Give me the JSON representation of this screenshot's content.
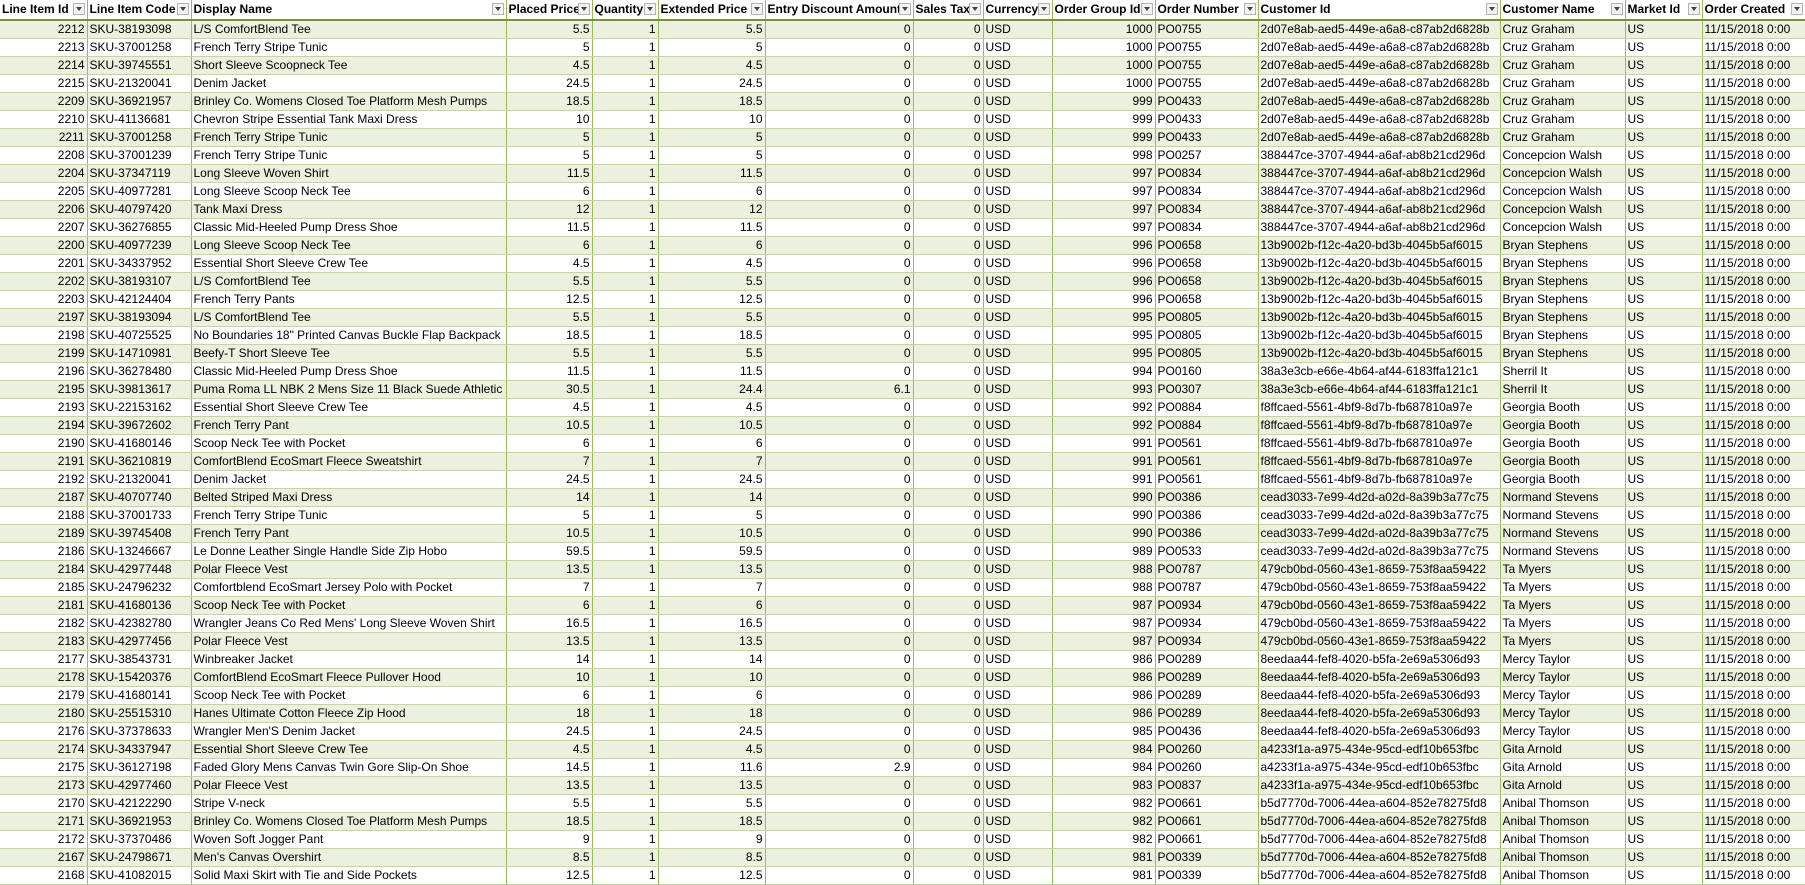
{
  "columns": [
    {
      "label": "Line Item Id",
      "align": "num"
    },
    {
      "label": "Line Item Code",
      "align": "txt"
    },
    {
      "label": "Display Name",
      "align": "txt"
    },
    {
      "label": "Placed Price",
      "align": "num"
    },
    {
      "label": "Quantity",
      "align": "num"
    },
    {
      "label": "Extended Price",
      "align": "num"
    },
    {
      "label": "Entry Discount Amount",
      "align": "num"
    },
    {
      "label": "Sales Tax",
      "align": "num"
    },
    {
      "label": "Currency",
      "align": "txt"
    },
    {
      "label": "Order Group Id",
      "align": "num"
    },
    {
      "label": "Order Number",
      "align": "txt"
    },
    {
      "label": "Customer Id",
      "align": "txt"
    },
    {
      "label": "Customer Name",
      "align": "txt"
    },
    {
      "label": "Market Id",
      "align": "txt"
    },
    {
      "label": "Order Created",
      "align": "txt"
    }
  ],
  "rows": [
    [
      "2212",
      "SKU-38193098",
      "L/S ComfortBlend Tee",
      "5.5",
      "1",
      "5.5",
      "0",
      "0",
      "USD",
      "1000",
      "PO0755",
      "2d07e8ab-aed5-449e-a6a8-c87ab2d6828b",
      "Cruz Graham",
      "US",
      "11/15/2018 0:00"
    ],
    [
      "2213",
      "SKU-37001258",
      "French Terry Stripe Tunic",
      "5",
      "1",
      "5",
      "0",
      "0",
      "USD",
      "1000",
      "PO0755",
      "2d07e8ab-aed5-449e-a6a8-c87ab2d6828b",
      "Cruz Graham",
      "US",
      "11/15/2018 0:00"
    ],
    [
      "2214",
      "SKU-39745551",
      "Short Sleeve Scoopneck Tee",
      "4.5",
      "1",
      "4.5",
      "0",
      "0",
      "USD",
      "1000",
      "PO0755",
      "2d07e8ab-aed5-449e-a6a8-c87ab2d6828b",
      "Cruz Graham",
      "US",
      "11/15/2018 0:00"
    ],
    [
      "2215",
      "SKU-21320041",
      "Denim Jacket",
      "24.5",
      "1",
      "24.5",
      "0",
      "0",
      "USD",
      "1000",
      "PO0755",
      "2d07e8ab-aed5-449e-a6a8-c87ab2d6828b",
      "Cruz Graham",
      "US",
      "11/15/2018 0:00"
    ],
    [
      "2209",
      "SKU-36921957",
      "Brinley Co. Womens Closed Toe Platform Mesh Pumps",
      "18.5",
      "1",
      "18.5",
      "0",
      "0",
      "USD",
      "999",
      "PO0433",
      "2d07e8ab-aed5-449e-a6a8-c87ab2d6828b",
      "Cruz Graham",
      "US",
      "11/15/2018 0:00"
    ],
    [
      "2210",
      "SKU-41136681",
      "Chevron Stripe Essential Tank Maxi Dress",
      "10",
      "1",
      "10",
      "0",
      "0",
      "USD",
      "999",
      "PO0433",
      "2d07e8ab-aed5-449e-a6a8-c87ab2d6828b",
      "Cruz Graham",
      "US",
      "11/15/2018 0:00"
    ],
    [
      "2211",
      "SKU-37001258",
      "French Terry Stripe Tunic",
      "5",
      "1",
      "5",
      "0",
      "0",
      "USD",
      "999",
      "PO0433",
      "2d07e8ab-aed5-449e-a6a8-c87ab2d6828b",
      "Cruz Graham",
      "US",
      "11/15/2018 0:00"
    ],
    [
      "2208",
      "SKU-37001239",
      "French Terry Stripe Tunic",
      "5",
      "1",
      "5",
      "0",
      "0",
      "USD",
      "998",
      "PO0257",
      "388447ce-3707-4944-a6af-ab8b21cd296d",
      "Concepcion Walsh",
      "US",
      "11/15/2018 0:00"
    ],
    [
      "2204",
      "SKU-37347119",
      "Long Sleeve Woven Shirt",
      "11.5",
      "1",
      "11.5",
      "0",
      "0",
      "USD",
      "997",
      "PO0834",
      "388447ce-3707-4944-a6af-ab8b21cd296d",
      "Concepcion Walsh",
      "US",
      "11/15/2018 0:00"
    ],
    [
      "2205",
      "SKU-40977281",
      "Long Sleeve Scoop Neck Tee",
      "6",
      "1",
      "6",
      "0",
      "0",
      "USD",
      "997",
      "PO0834",
      "388447ce-3707-4944-a6af-ab8b21cd296d",
      "Concepcion Walsh",
      "US",
      "11/15/2018 0:00"
    ],
    [
      "2206",
      "SKU-40797420",
      "Tank Maxi Dress",
      "12",
      "1",
      "12",
      "0",
      "0",
      "USD",
      "997",
      "PO0834",
      "388447ce-3707-4944-a6af-ab8b21cd296d",
      "Concepcion Walsh",
      "US",
      "11/15/2018 0:00"
    ],
    [
      "2207",
      "SKU-36276855",
      "Classic Mid-Heeled Pump Dress Shoe",
      "11.5",
      "1",
      "11.5",
      "0",
      "0",
      "USD",
      "997",
      "PO0834",
      "388447ce-3707-4944-a6af-ab8b21cd296d",
      "Concepcion Walsh",
      "US",
      "11/15/2018 0:00"
    ],
    [
      "2200",
      "SKU-40977239",
      "Long Sleeve Scoop Neck Tee",
      "6",
      "1",
      "6",
      "0",
      "0",
      "USD",
      "996",
      "PO0658",
      "13b9002b-f12c-4a20-bd3b-4045b5af6015",
      "Bryan Stephens",
      "US",
      "11/15/2018 0:00"
    ],
    [
      "2201",
      "SKU-34337952",
      "Essential Short Sleeve Crew Tee",
      "4.5",
      "1",
      "4.5",
      "0",
      "0",
      "USD",
      "996",
      "PO0658",
      "13b9002b-f12c-4a20-bd3b-4045b5af6015",
      "Bryan Stephens",
      "US",
      "11/15/2018 0:00"
    ],
    [
      "2202",
      "SKU-38193107",
      "L/S ComfortBlend Tee",
      "5.5",
      "1",
      "5.5",
      "0",
      "0",
      "USD",
      "996",
      "PO0658",
      "13b9002b-f12c-4a20-bd3b-4045b5af6015",
      "Bryan Stephens",
      "US",
      "11/15/2018 0:00"
    ],
    [
      "2203",
      "SKU-42124404",
      "French Terry Pants",
      "12.5",
      "1",
      "12.5",
      "0",
      "0",
      "USD",
      "996",
      "PO0658",
      "13b9002b-f12c-4a20-bd3b-4045b5af6015",
      "Bryan Stephens",
      "US",
      "11/15/2018 0:00"
    ],
    [
      "2197",
      "SKU-38193094",
      "L/S ComfortBlend Tee",
      "5.5",
      "1",
      "5.5",
      "0",
      "0",
      "USD",
      "995",
      "PO0805",
      "13b9002b-f12c-4a20-bd3b-4045b5af6015",
      "Bryan Stephens",
      "US",
      "11/15/2018 0:00"
    ],
    [
      "2198",
      "SKU-40725525",
      "No Boundaries 18\" Printed Canvas Buckle Flap Backpack",
      "18.5",
      "1",
      "18.5",
      "0",
      "0",
      "USD",
      "995",
      "PO0805",
      "13b9002b-f12c-4a20-bd3b-4045b5af6015",
      "Bryan Stephens",
      "US",
      "11/15/2018 0:00"
    ],
    [
      "2199",
      "SKU-14710981",
      "Beefy-T Short Sleeve Tee",
      "5.5",
      "1",
      "5.5",
      "0",
      "0",
      "USD",
      "995",
      "PO0805",
      "13b9002b-f12c-4a20-bd3b-4045b5af6015",
      "Bryan Stephens",
      "US",
      "11/15/2018 0:00"
    ],
    [
      "2196",
      "SKU-36278480",
      "Classic Mid-Heeled Pump Dress Shoe",
      "11.5",
      "1",
      "11.5",
      "0",
      "0",
      "USD",
      "994",
      "PO0160",
      "38a3e3cb-e66e-4b64-af44-6183ffa121c1",
      "Sherril It",
      "US",
      "11/15/2018 0:00"
    ],
    [
      "2195",
      "SKU-39813617",
      "Puma Roma LL NBK 2 Mens Size 11 Black Suede Athletic Sneakers",
      "30.5",
      "1",
      "24.4",
      "6.1",
      "0",
      "USD",
      "993",
      "PO0307",
      "38a3e3cb-e66e-4b64-af44-6183ffa121c1",
      "Sherril It",
      "US",
      "11/15/2018 0:00"
    ],
    [
      "2193",
      "SKU-22153162",
      "Essential Short Sleeve Crew Tee",
      "4.5",
      "1",
      "4.5",
      "0",
      "0",
      "USD",
      "992",
      "PO0884",
      "f8ffcaed-5561-4bf9-8d7b-fb687810a97e",
      "Georgia Booth",
      "US",
      "11/15/2018 0:00"
    ],
    [
      "2194",
      "SKU-39672602",
      "French Terry Pant",
      "10.5",
      "1",
      "10.5",
      "0",
      "0",
      "USD",
      "992",
      "PO0884",
      "f8ffcaed-5561-4bf9-8d7b-fb687810a97e",
      "Georgia Booth",
      "US",
      "11/15/2018 0:00"
    ],
    [
      "2190",
      "SKU-41680146",
      "Scoop Neck Tee with Pocket",
      "6",
      "1",
      "6",
      "0",
      "0",
      "USD",
      "991",
      "PO0561",
      "f8ffcaed-5561-4bf9-8d7b-fb687810a97e",
      "Georgia Booth",
      "US",
      "11/15/2018 0:00"
    ],
    [
      "2191",
      "SKU-36210819",
      "ComfortBlend EcoSmart Fleece Sweatshirt",
      "7",
      "1",
      "7",
      "0",
      "0",
      "USD",
      "991",
      "PO0561",
      "f8ffcaed-5561-4bf9-8d7b-fb687810a97e",
      "Georgia Booth",
      "US",
      "11/15/2018 0:00"
    ],
    [
      "2192",
      "SKU-21320041",
      "Denim Jacket",
      "24.5",
      "1",
      "24.5",
      "0",
      "0",
      "USD",
      "991",
      "PO0561",
      "f8ffcaed-5561-4bf9-8d7b-fb687810a97e",
      "Georgia Booth",
      "US",
      "11/15/2018 0:00"
    ],
    [
      "2187",
      "SKU-40707740",
      "Belted Striped Maxi Dress",
      "14",
      "1",
      "14",
      "0",
      "0",
      "USD",
      "990",
      "PO0386",
      "cead3033-7e99-4d2d-a02d-8a39b3a77c75",
      "Normand Stevens",
      "US",
      "11/15/2018 0:00"
    ],
    [
      "2188",
      "SKU-37001733",
      "French Terry Stripe Tunic",
      "5",
      "1",
      "5",
      "0",
      "0",
      "USD",
      "990",
      "PO0386",
      "cead3033-7e99-4d2d-a02d-8a39b3a77c75",
      "Normand Stevens",
      "US",
      "11/15/2018 0:00"
    ],
    [
      "2189",
      "SKU-39745408",
      "French Terry Pant",
      "10.5",
      "1",
      "10.5",
      "0",
      "0",
      "USD",
      "990",
      "PO0386",
      "cead3033-7e99-4d2d-a02d-8a39b3a77c75",
      "Normand Stevens",
      "US",
      "11/15/2018 0:00"
    ],
    [
      "2186",
      "SKU-13246667",
      "Le Donne Leather Single Handle Side Zip Hobo",
      "59.5",
      "1",
      "59.5",
      "0",
      "0",
      "USD",
      "989",
      "PO0533",
      "cead3033-7e99-4d2d-a02d-8a39b3a77c75",
      "Normand Stevens",
      "US",
      "11/15/2018 0:00"
    ],
    [
      "2184",
      "SKU-42977448",
      "Polar Fleece Vest",
      "13.5",
      "1",
      "13.5",
      "0",
      "0",
      "USD",
      "988",
      "PO0787",
      "479cb0bd-0560-43e1-8659-753f8aa59422",
      "Ta Myers",
      "US",
      "11/15/2018 0:00"
    ],
    [
      "2185",
      "SKU-24796232",
      "Comfortblend EcoSmart Jersey Polo with Pocket",
      "7",
      "1",
      "7",
      "0",
      "0",
      "USD",
      "988",
      "PO0787",
      "479cb0bd-0560-43e1-8659-753f8aa59422",
      "Ta Myers",
      "US",
      "11/15/2018 0:00"
    ],
    [
      "2181",
      "SKU-41680136",
      "Scoop Neck Tee with Pocket",
      "6",
      "1",
      "6",
      "0",
      "0",
      "USD",
      "987",
      "PO0934",
      "479cb0bd-0560-43e1-8659-753f8aa59422",
      "Ta Myers",
      "US",
      "11/15/2018 0:00"
    ],
    [
      "2182",
      "SKU-42382780",
      "Wrangler Jeans Co Red Mens' Long Sleeve Woven Shirt",
      "16.5",
      "1",
      "16.5",
      "0",
      "0",
      "USD",
      "987",
      "PO0934",
      "479cb0bd-0560-43e1-8659-753f8aa59422",
      "Ta Myers",
      "US",
      "11/15/2018 0:00"
    ],
    [
      "2183",
      "SKU-42977456",
      "Polar Fleece Vest",
      "13.5",
      "1",
      "13.5",
      "0",
      "0",
      "USD",
      "987",
      "PO0934",
      "479cb0bd-0560-43e1-8659-753f8aa59422",
      "Ta Myers",
      "US",
      "11/15/2018 0:00"
    ],
    [
      "2177",
      "SKU-38543731",
      "Winbreaker Jacket",
      "14",
      "1",
      "14",
      "0",
      "0",
      "USD",
      "986",
      "PO0289",
      "8eedaa44-fef8-4020-b5fa-2e69a5306d93",
      "Mercy Taylor",
      "US",
      "11/15/2018 0:00"
    ],
    [
      "2178",
      "SKU-15420376",
      "ComfortBlend EcoSmart Fleece Pullover Hood",
      "10",
      "1",
      "10",
      "0",
      "0",
      "USD",
      "986",
      "PO0289",
      "8eedaa44-fef8-4020-b5fa-2e69a5306d93",
      "Mercy Taylor",
      "US",
      "11/15/2018 0:00"
    ],
    [
      "2179",
      "SKU-41680141",
      "Scoop Neck Tee with Pocket",
      "6",
      "1",
      "6",
      "0",
      "0",
      "USD",
      "986",
      "PO0289",
      "8eedaa44-fef8-4020-b5fa-2e69a5306d93",
      "Mercy Taylor",
      "US",
      "11/15/2018 0:00"
    ],
    [
      "2180",
      "SKU-25515310",
      "Hanes Ultimate Cotton Fleece Zip Hood",
      "18",
      "1",
      "18",
      "0",
      "0",
      "USD",
      "986",
      "PO0289",
      "8eedaa44-fef8-4020-b5fa-2e69a5306d93",
      "Mercy Taylor",
      "US",
      "11/15/2018 0:00"
    ],
    [
      "2176",
      "SKU-37378633",
      "Wrangler Men'S Denim Jacket",
      "24.5",
      "1",
      "24.5",
      "0",
      "0",
      "USD",
      "985",
      "PO0436",
      "8eedaa44-fef8-4020-b5fa-2e69a5306d93",
      "Mercy Taylor",
      "US",
      "11/15/2018 0:00"
    ],
    [
      "2174",
      "SKU-34337947",
      "Essential Short Sleeve Crew Tee",
      "4.5",
      "1",
      "4.5",
      "0",
      "0",
      "USD",
      "984",
      "PO0260",
      "a4233f1a-a975-434e-95cd-edf10b653fbc",
      "Gita Arnold",
      "US",
      "11/15/2018 0:00"
    ],
    [
      "2175",
      "SKU-36127198",
      "Faded Glory Mens Canvas Twin Gore Slip-On Shoe",
      "14.5",
      "1",
      "11.6",
      "2.9",
      "0",
      "USD",
      "984",
      "PO0260",
      "a4233f1a-a975-434e-95cd-edf10b653fbc",
      "Gita Arnold",
      "US",
      "11/15/2018 0:00"
    ],
    [
      "2173",
      "SKU-42977460",
      "Polar Fleece Vest",
      "13.5",
      "1",
      "13.5",
      "0",
      "0",
      "USD",
      "983",
      "PO0837",
      "a4233f1a-a975-434e-95cd-edf10b653fbc",
      "Gita Arnold",
      "US",
      "11/15/2018 0:00"
    ],
    [
      "2170",
      "SKU-42122290",
      "Stripe V-neck",
      "5.5",
      "1",
      "5.5",
      "0",
      "0",
      "USD",
      "982",
      "PO0661",
      "b5d7770d-7006-44ea-a604-852e78275fd8",
      "Anibal Thomson",
      "US",
      "11/15/2018 0:00"
    ],
    [
      "2171",
      "SKU-36921953",
      "Brinley Co. Womens Closed Toe Platform Mesh Pumps",
      "18.5",
      "1",
      "18.5",
      "0",
      "0",
      "USD",
      "982",
      "PO0661",
      "b5d7770d-7006-44ea-a604-852e78275fd8",
      "Anibal Thomson",
      "US",
      "11/15/2018 0:00"
    ],
    [
      "2172",
      "SKU-37370486",
      "Woven Soft Jogger Pant",
      "9",
      "1",
      "9",
      "0",
      "0",
      "USD",
      "982",
      "PO0661",
      "b5d7770d-7006-44ea-a604-852e78275fd8",
      "Anibal Thomson",
      "US",
      "11/15/2018 0:00"
    ],
    [
      "2167",
      "SKU-24798671",
      "Men's Canvas Overshirt",
      "8.5",
      "1",
      "8.5",
      "0",
      "0",
      "USD",
      "981",
      "PO0339",
      "b5d7770d-7006-44ea-a604-852e78275fd8",
      "Anibal Thomson",
      "US",
      "11/15/2018 0:00"
    ],
    [
      "2168",
      "SKU-41082015",
      "Solid Maxi Skirt with Tie and Side Pockets",
      "12.5",
      "1",
      "12.5",
      "0",
      "0",
      "USD",
      "981",
      "PO0339",
      "b5d7770d-7006-44ea-a604-852e78275fd8",
      "Anibal Thomson",
      "US",
      "11/15/2018 0:00"
    ]
  ]
}
